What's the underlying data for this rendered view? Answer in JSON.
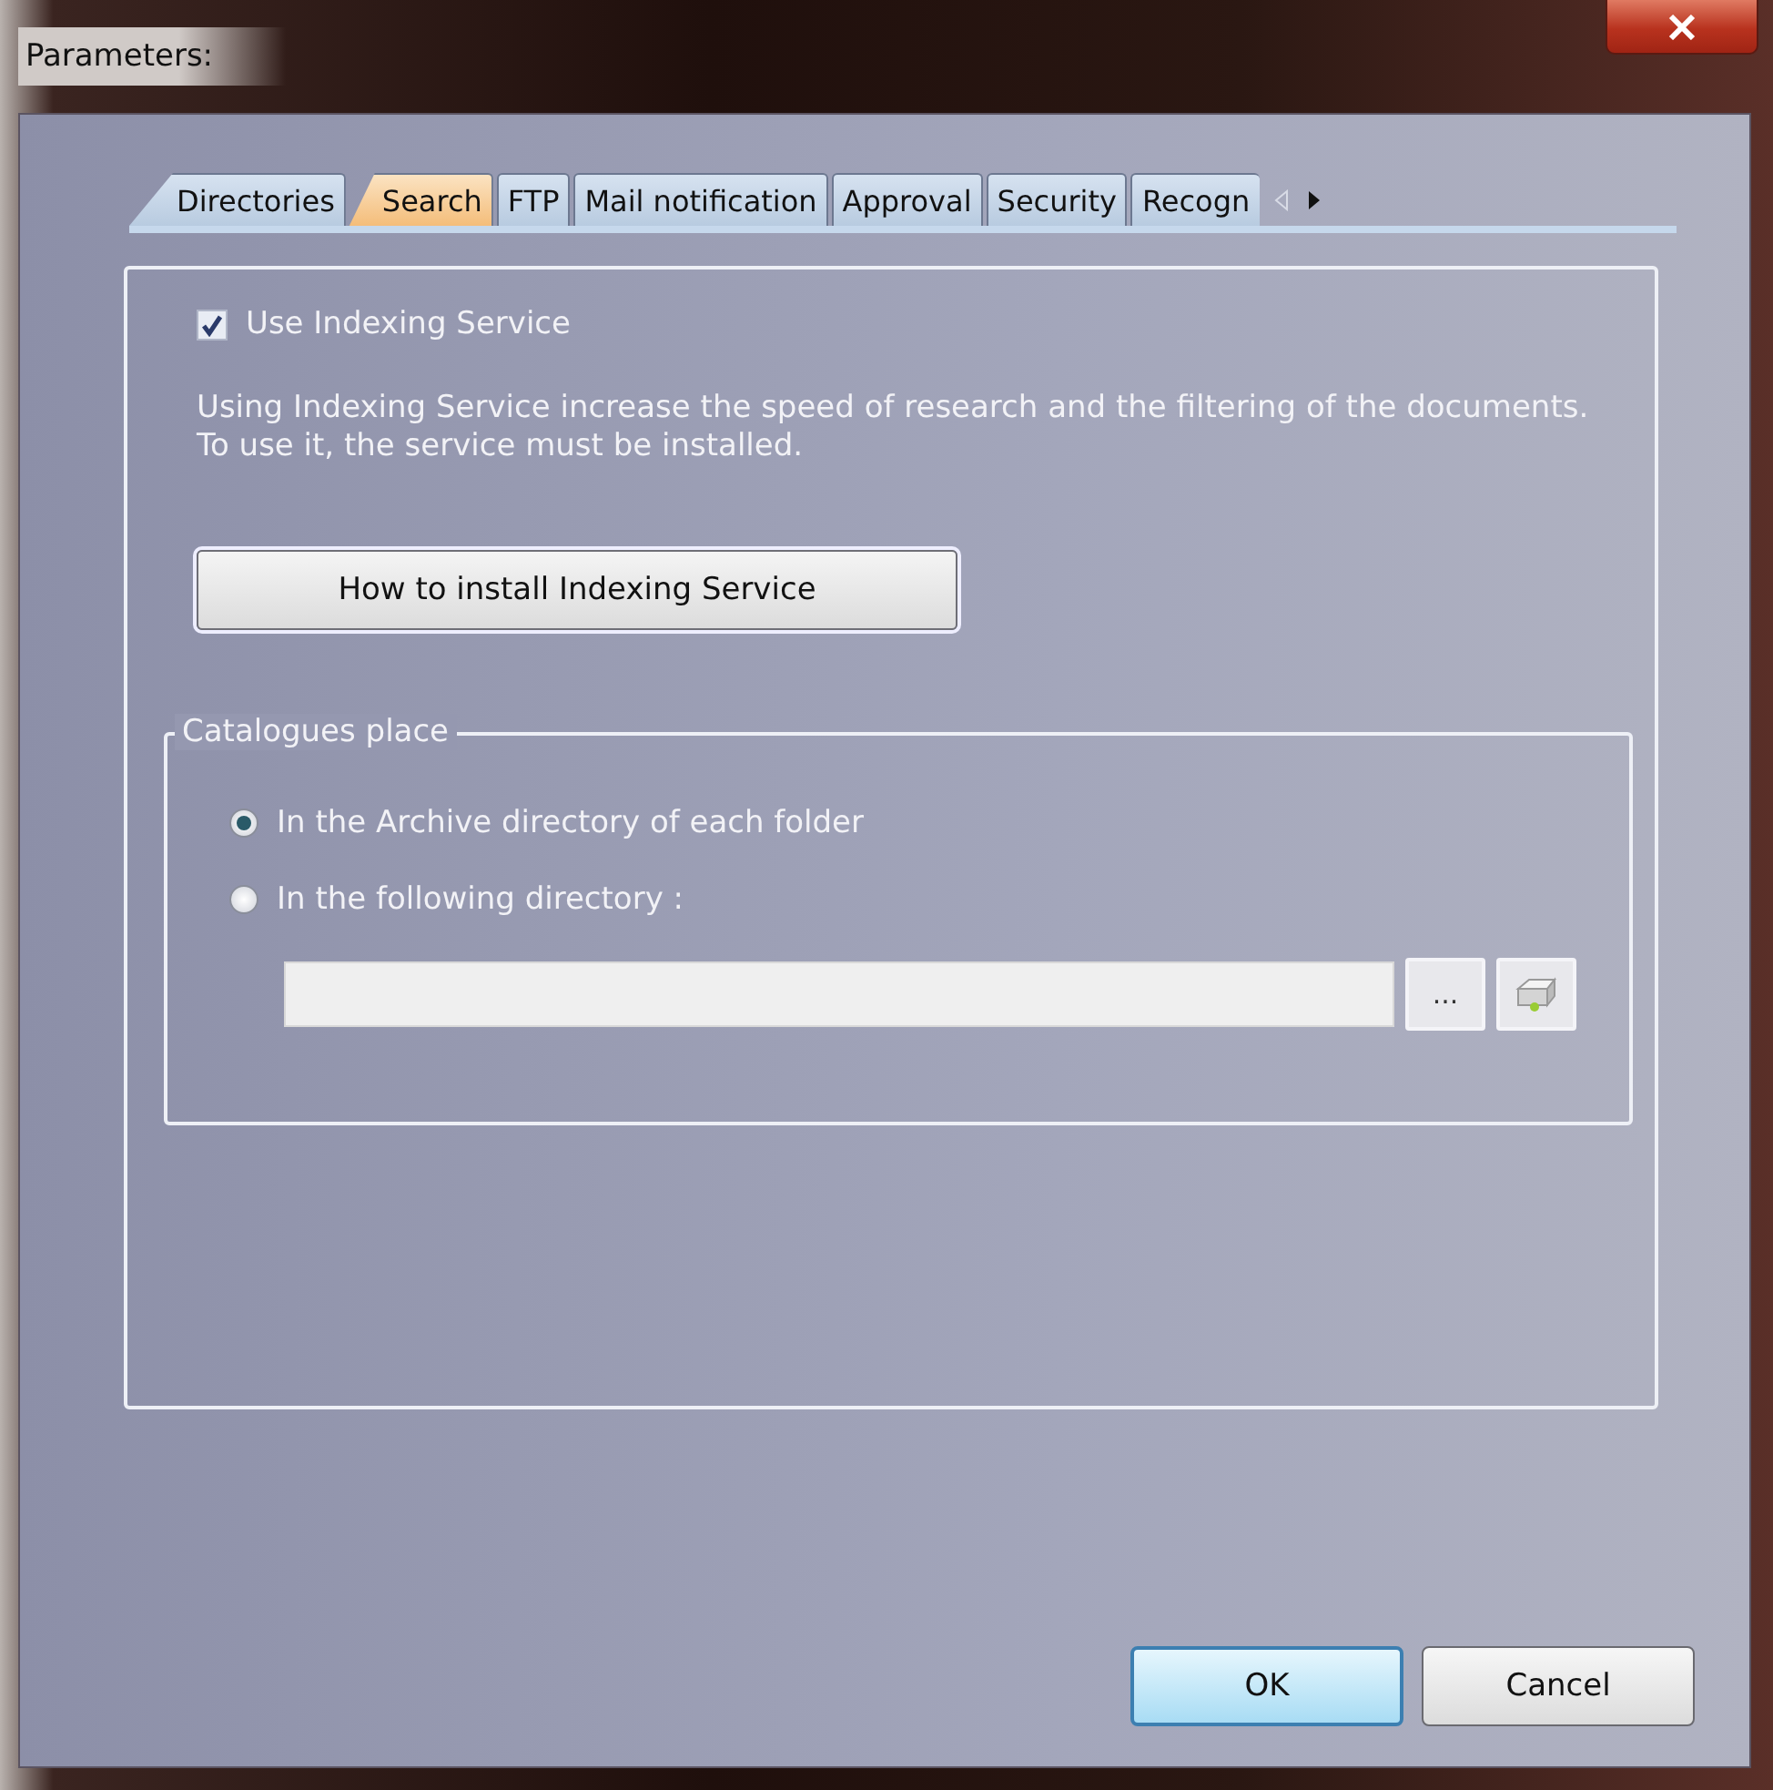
{
  "window": {
    "title": "Parameters:"
  },
  "tabs": [
    {
      "label": "Directories",
      "selected": false
    },
    {
      "label": "Search",
      "selected": true
    },
    {
      "label": "FTP",
      "selected": false
    },
    {
      "label": "Mail notification",
      "selected": false
    },
    {
      "label": "Approval",
      "selected": false
    },
    {
      "label": "Security",
      "selected": false
    },
    {
      "label": "Recogn",
      "selected": false
    }
  ],
  "use_indexing": {
    "label": "Use Indexing Service",
    "checked": true
  },
  "description": "Using Indexing Service increase the speed of research and the filtering of the documents. To use it, the service must be installed.",
  "install_button": "How to install Indexing Service",
  "catalogues": {
    "title": "Catalogues place",
    "options": [
      {
        "label": "In the Archive directory of each folder",
        "selected": true
      },
      {
        "label": "In the following directory :",
        "selected": false
      }
    ],
    "browse_button": "..."
  },
  "buttons": [
    "OK",
    "Cancel"
  ]
}
